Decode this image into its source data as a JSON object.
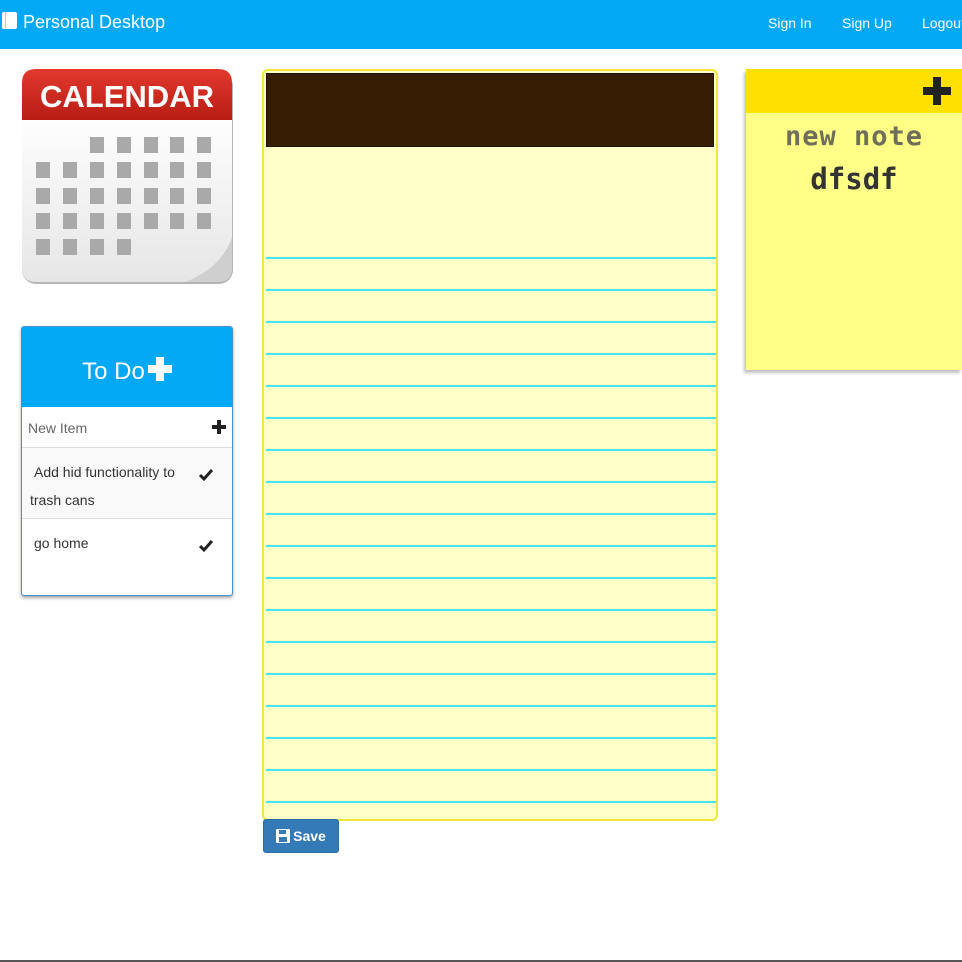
{
  "navbar": {
    "brand": "Personal Desktop",
    "links": [
      "Sign In",
      "Sign Up",
      "Logout"
    ]
  },
  "calendar": {
    "title": "CALENDAR"
  },
  "todo": {
    "title": "To Do",
    "new_item_placeholder": "New Item",
    "items": [
      "Add hid functionality to trash cans",
      "go home"
    ]
  },
  "notepad": {
    "content": "",
    "save_label": "Save"
  },
  "sticky_note": {
    "title": "new note",
    "body": "dfsdf"
  },
  "colors": {
    "navbar": "#03a9f4",
    "notepad_paper": "#ffffc6",
    "notepad_lines": "#4fe0ee",
    "sticky_header": "#ffe000",
    "sticky_body": "#ffff88",
    "save_button": "#337ab7"
  },
  "icons": {
    "brand": "book-icon",
    "todo_add": "plus-icon",
    "new_item_add": "plus-icon",
    "item_done": "check-icon",
    "save": "floppy-disk-icon",
    "sticky_add": "plus-icon"
  }
}
